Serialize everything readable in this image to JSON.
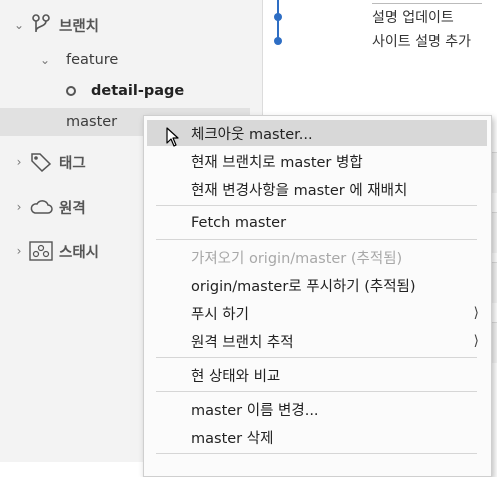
{
  "sidebar": {
    "branches_label": "브랜치",
    "feature_label": "feature",
    "detail_page_label": "detail-page",
    "master_label": "master",
    "tags_label": "태그",
    "remotes_label": "원격",
    "stash_label": "스태시"
  },
  "commits": {
    "c1": "설명 업데이트",
    "c2": "사이트 설명 추가"
  },
  "context_menu": {
    "checkout": "체크아웃 master...",
    "merge": "현재 브랜치로 master 병합",
    "rebase": "현재 변경사항을 master 에 재배치",
    "fetch": "Fetch master",
    "pull": "가져오기 origin/master (추적됨)",
    "push_to": "origin/master로 푸시하기 (추적됨)",
    "push": "푸시 하기",
    "track_remote": "원격 브랜치 추적",
    "compare": "현 상태와 비교",
    "rename": "master 이름 변경...",
    "delete": "master 삭제"
  },
  "colors": {
    "graph": "#2e6ec4",
    "menu_hover": "#d8d8d8"
  }
}
